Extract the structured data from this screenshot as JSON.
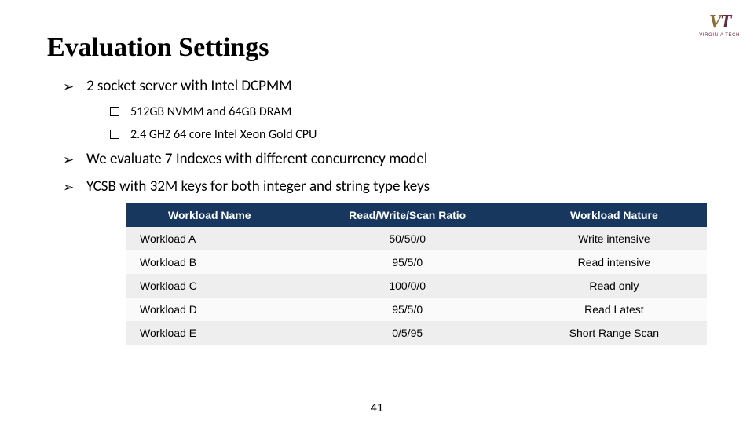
{
  "logo": {
    "brand": "VT",
    "sub": "VIRGINIA TECH"
  },
  "title": "Evaluation Settings",
  "bullets": {
    "b1": "2 socket server with Intel DCPMM",
    "b1_sub": [
      "512GB NVMM and 64GB DRAM",
      "2.4 GHZ 64 core Intel Xeon Gold CPU"
    ],
    "b2": "We evaluate 7 Indexes with different concurrency model",
    "b3": "YCSB with 32M keys for both integer and string type keys"
  },
  "table": {
    "headers": [
      "Workload Name",
      "Read/Write/Scan Ratio",
      "Workload Nature"
    ],
    "rows": [
      {
        "name": "Workload A",
        "ratio": "50/50/0",
        "nature": "Write intensive"
      },
      {
        "name": "Workload B",
        "ratio": "95/5/0",
        "nature": "Read intensive"
      },
      {
        "name": "Workload C",
        "ratio": "100/0/0",
        "nature": "Read only"
      },
      {
        "name": "Workload D",
        "ratio": "95/5/0",
        "nature": "Read Latest"
      },
      {
        "name": "Workload E",
        "ratio": "0/5/95",
        "nature": "Short Range Scan"
      }
    ]
  },
  "page": "41"
}
